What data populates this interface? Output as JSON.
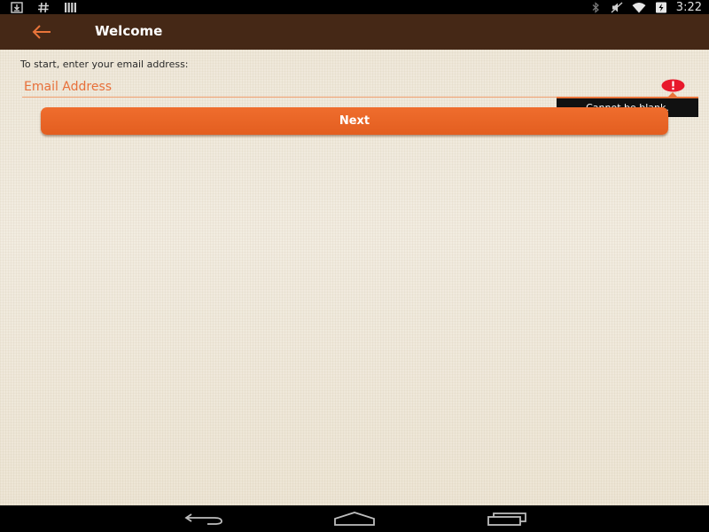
{
  "status_bar": {
    "time": "3:22",
    "left_icons": [
      "download-icon",
      "hash-icon",
      "signal-bars-icon"
    ],
    "right_icons": [
      "bluetooth-icon",
      "mute-icon",
      "wifi-icon",
      "battery-charging-icon"
    ]
  },
  "app_bar": {
    "title": "Welcome",
    "back_icon": "arrow-left-icon",
    "background_color": "#452816",
    "accent_color": "#e8743a"
  },
  "form": {
    "instruction": "To start, enter your email address:",
    "email": {
      "value": "",
      "placeholder": "Email Address",
      "error_icon": "error-exclamation-icon",
      "error_message": "Cannot be blank.",
      "error_color": "#e8192c"
    },
    "next_button": {
      "label": "Next",
      "color": "#e8632a"
    }
  },
  "nav_bar": {
    "items": [
      "back-nav-icon",
      "home-nav-icon",
      "recents-nav-icon"
    ]
  }
}
